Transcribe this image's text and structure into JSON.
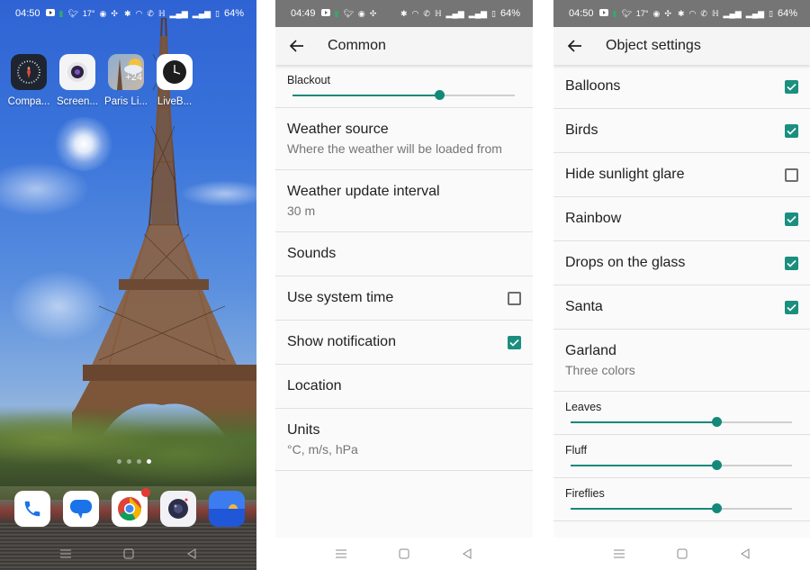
{
  "colors": {
    "accent": "#14897a",
    "checkbox_checked": "#1a8f7f",
    "appbar_bg": "#f5f5f5",
    "statusbar_bg": "#757575"
  },
  "home": {
    "status": {
      "time": "04:50",
      "temperature": "17°",
      "battery": "64%",
      "left_icons": [
        "youtube-icon",
        "app-icon",
        "twitter-icon",
        "temperature",
        "browser-icon",
        "fan-icon"
      ],
      "right_icons": [
        "bluetooth-icon",
        "wifi-icon",
        "call-icon",
        "volte-icon",
        "signal-icon",
        "signal-icon",
        "battery-icon"
      ]
    },
    "apps": [
      {
        "label": "Compa...",
        "icon": "compass-icon"
      },
      {
        "label": "Screen...",
        "icon": "screen-recorder-icon"
      },
      {
        "label": "Paris Li...",
        "icon": "paris-live-wallpaper-icon",
        "icon_text": "+24"
      },
      {
        "label": "LiveB...",
        "icon": "clock-icon"
      }
    ],
    "page_indicator": {
      "count": 4,
      "active": 4
    },
    "dock": [
      {
        "name": "phone",
        "icon": "phone-icon"
      },
      {
        "name": "messages",
        "icon": "messages-icon"
      },
      {
        "name": "chrome",
        "icon": "chrome-icon",
        "badge": true
      },
      {
        "name": "camera",
        "icon": "camera-icon"
      },
      {
        "name": "gallery",
        "icon": "gallery-icon"
      }
    ]
  },
  "common": {
    "status": {
      "time": "04:49",
      "battery": "64%"
    },
    "title": "Common",
    "blackout": {
      "label": "Blackout",
      "value_fraction": 0.66
    },
    "items": [
      {
        "title": "Weather source",
        "subtitle": "Where the weather will be loaded from"
      },
      {
        "title": "Weather update interval",
        "subtitle": "30 m"
      },
      {
        "title": "Sounds"
      },
      {
        "title": "Use system time",
        "checked": false
      },
      {
        "title": "Show notification",
        "checked": true
      },
      {
        "title": "Location"
      },
      {
        "title": "Units",
        "subtitle": "°C, m/s, hPa"
      }
    ]
  },
  "objects": {
    "status": {
      "time": "04:50",
      "temperature": "17°",
      "battery": "64%"
    },
    "title": "Object settings",
    "toggles": [
      {
        "title": "Balloons",
        "checked": true
      },
      {
        "title": "Birds",
        "checked": true
      },
      {
        "title": "Hide sunlight glare",
        "checked": false
      },
      {
        "title": "Rainbow",
        "checked": true
      },
      {
        "title": "Drops on the glass",
        "checked": true
      },
      {
        "title": "Santa",
        "checked": true
      }
    ],
    "garland": {
      "title": "Garland",
      "subtitle": "Three colors"
    },
    "sliders": [
      {
        "label": "Leaves",
        "value_fraction": 0.66
      },
      {
        "label": "Fluff",
        "value_fraction": 0.66
      },
      {
        "label": "Fireflies",
        "value_fraction": 0.66
      }
    ]
  }
}
